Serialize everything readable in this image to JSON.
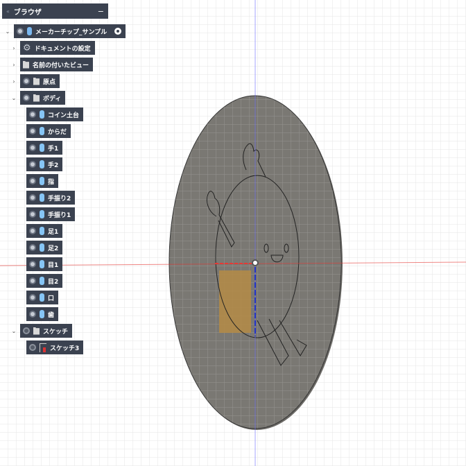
{
  "browser": {
    "title": "ブラウザ",
    "root": {
      "label": "メーカーチップ_サンプル",
      "icon": "component-icon"
    },
    "items": [
      {
        "label": "ドキュメントの設定",
        "icon": "gear-icon",
        "expander": "›"
      },
      {
        "label": "名前の付いたビュー",
        "icon": "folder-icon",
        "expander": "›"
      },
      {
        "label": "原点",
        "icon": "folder-icon",
        "expander": "›"
      },
      {
        "label": "ボディ",
        "icon": "folder-icon",
        "expander": "⌄"
      }
    ],
    "bodies": [
      "コイン土台",
      "からだ",
      "手1",
      "手2",
      "指",
      "手振り2",
      "手振り1",
      "足1",
      "足2",
      "目1",
      "目2",
      "口",
      "歯"
    ],
    "sketches_folder": {
      "label": "スケッチ",
      "expander": "⌄"
    },
    "sketches": [
      "スケッチ3"
    ]
  },
  "colors": {
    "panel": "#3b4250",
    "body_icon": "#86c5f5",
    "disk": "#7a7873",
    "x_axis": "#e53935",
    "y_axis": "#2233cc",
    "sketch_fill": "#b58b45"
  }
}
